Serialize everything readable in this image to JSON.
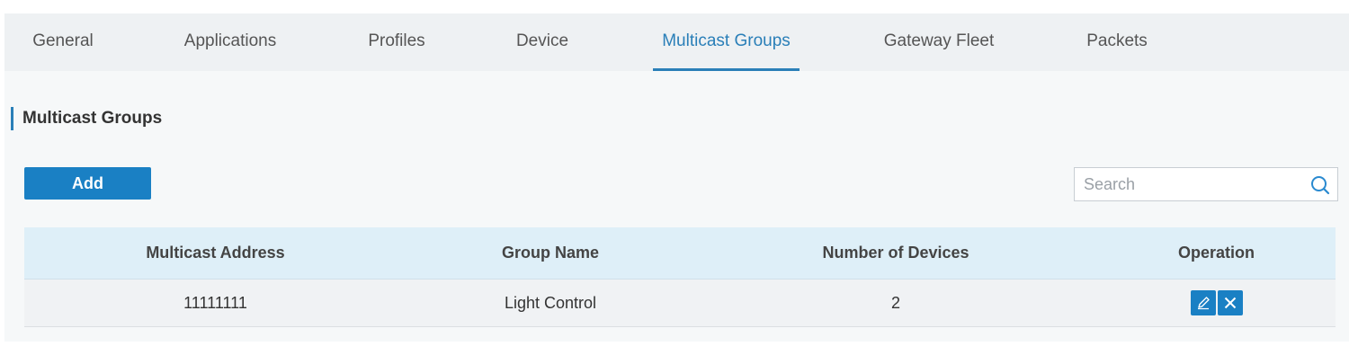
{
  "tabs": [
    {
      "label": "General"
    },
    {
      "label": "Applications"
    },
    {
      "label": "Profiles"
    },
    {
      "label": "Device"
    },
    {
      "label": "Multicast Groups",
      "active": true
    },
    {
      "label": "Gateway Fleet"
    },
    {
      "label": "Packets"
    }
  ],
  "section": {
    "title": "Multicast Groups"
  },
  "toolbar": {
    "add_label": "Add"
  },
  "search": {
    "placeholder": "Search",
    "value": ""
  },
  "table": {
    "columns": [
      "Multicast Address",
      "Group Name",
      "Number of Devices",
      "Operation"
    ],
    "rows": [
      {
        "multicast_address": "11111111",
        "group_name": "Light Control",
        "number_of_devices": "2"
      }
    ]
  },
  "icons": {
    "search": "search-icon",
    "edit": "pencil-icon",
    "delete": "close-icon"
  },
  "colors": {
    "accent": "#1a80c4",
    "active_tab": "#2a7fb8",
    "header_bg": "#deeff8"
  }
}
